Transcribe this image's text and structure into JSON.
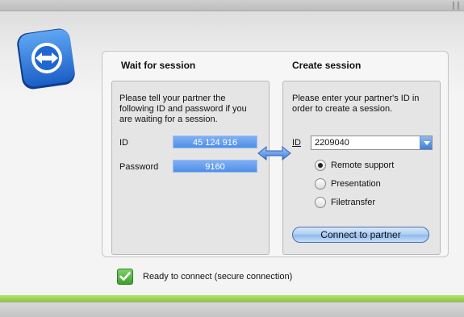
{
  "left_section": {
    "heading": "Wait for session",
    "description": [
      "Please tell your partner the",
      "following ID and password if you",
      "are waiting for a session."
    ],
    "id_label": "ID",
    "id_value": "45 124 916",
    "password_label": "Password",
    "password_value": "9160"
  },
  "right_section": {
    "heading": "Create session",
    "description": [
      "Please enter your partner's ID in",
      "order to create a session."
    ],
    "id_label": "ID",
    "id_input_value": "2209040",
    "options": [
      {
        "label": "Remote support",
        "checked": true
      },
      {
        "label": "Presentation",
        "checked": false
      },
      {
        "label": "Filetransfer",
        "checked": false
      }
    ],
    "connect_button": "Connect to partner"
  },
  "status": {
    "text": "Ready to connect (secure connection)",
    "icon": "checkmark-icon",
    "color": "#4cb336"
  },
  "icons": {
    "logo": "teamviewer-logo-icon",
    "arrow": "double-arrow-icon"
  },
  "colors": {
    "value_box": "#5b97ea",
    "footer_accent": "#9fd356"
  }
}
